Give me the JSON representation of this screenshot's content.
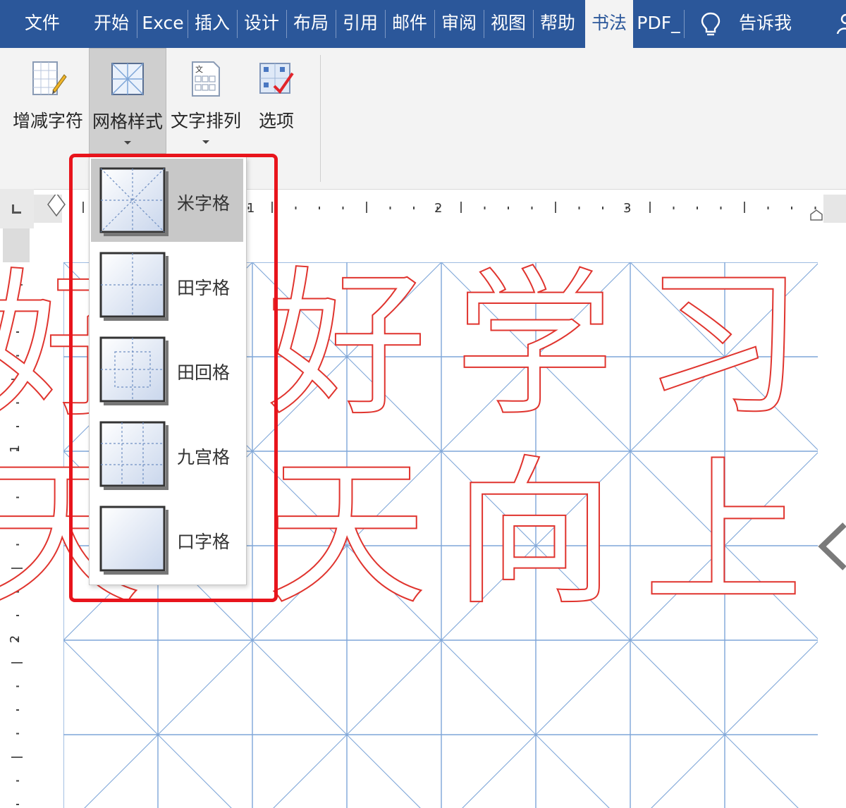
{
  "tabs": [
    {
      "label": "文件"
    },
    {
      "label": "开始"
    },
    {
      "label": "Exce"
    },
    {
      "label": "插入"
    },
    {
      "label": "设计"
    },
    {
      "label": "布局"
    },
    {
      "label": "引用"
    },
    {
      "label": "邮件"
    },
    {
      "label": "审阅"
    },
    {
      "label": "视图"
    },
    {
      "label": "帮助"
    },
    {
      "label": "书法",
      "active": true
    },
    {
      "label": "PDF_"
    }
  ],
  "tell_me": "告诉我",
  "ribbon": {
    "buttons": [
      {
        "label": "增减字符",
        "icon": "add-characters-icon"
      },
      {
        "label": "网格样式",
        "icon": "grid-style-icon",
        "pressed": true
      },
      {
        "label": "文字排列",
        "icon": "text-arrangement-icon"
      },
      {
        "label": "选项",
        "icon": "options-icon"
      }
    ]
  },
  "ruler": {
    "h_numbers": [
      "1",
      "2",
      "3"
    ],
    "v_numbers": [
      "1",
      "2"
    ]
  },
  "dropdown": {
    "items": [
      {
        "label": "米字格",
        "icon": "mi-grid-icon",
        "selected": true
      },
      {
        "label": "田字格",
        "icon": "tian-grid-icon"
      },
      {
        "label": "田回格",
        "icon": "tian-hui-grid-icon"
      },
      {
        "label": "九宫格",
        "icon": "nine-grid-icon"
      },
      {
        "label": "口字格",
        "icon": "kou-grid-icon"
      }
    ]
  },
  "document": {
    "characters": [
      "好",
      "学",
      "习",
      "天",
      "向",
      "上"
    ]
  },
  "colors": {
    "tab_bar": "#2b579a",
    "grid_line": "#7ea6d8",
    "glyph_outline": "#e0342e",
    "highlight": "#e8141c"
  }
}
